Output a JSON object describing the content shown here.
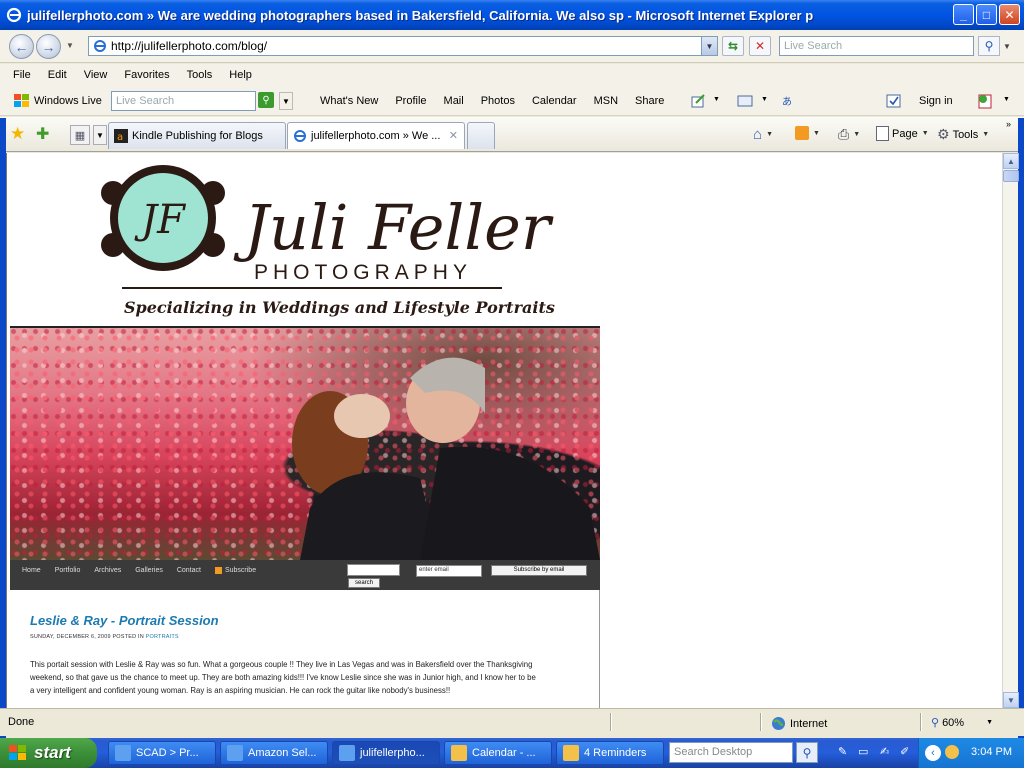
{
  "window": {
    "title": "julifellerphoto.com » We are wedding photographers based in Bakersfield, California. We also sp - Microsoft Internet Explorer p"
  },
  "address_bar": {
    "url": "http://julifellerphoto.com/blog/",
    "search_placeholder": "Live Search"
  },
  "menu": [
    "File",
    "Edit",
    "View",
    "Favorites",
    "Tools",
    "Help"
  ],
  "live_toolbar": {
    "brand": "Windows Live",
    "search_placeholder": "Live Search",
    "links": [
      "What's New",
      "Profile",
      "Mail",
      "Photos",
      "Calendar",
      "MSN",
      "Share"
    ],
    "sign_in": "Sign in"
  },
  "tabs": [
    {
      "label": "Kindle Publishing for Blogs"
    },
    {
      "label": "julifellerphoto.com » We ..."
    }
  ],
  "command_bar": {
    "page": "Page",
    "tools": "Tools"
  },
  "site": {
    "logo_monogram": "JF",
    "logo_name": "Juli Feller",
    "logo_sub": "PHOTOGRAPHY",
    "tagline": "Specializing in Weddings and Lifestyle Portraits",
    "nav": [
      "Home",
      "Portfolio",
      "Archives",
      "Galleries",
      "Contact",
      "Subscribe"
    ],
    "search_button": "search",
    "email_placeholder": "enter email",
    "subscribe_button": "Subscribe by email"
  },
  "post": {
    "title": "Leslie & Ray - Portrait Session",
    "meta_prefix": "SUNDAY, DECEMBER 6, 2009 POSTED IN",
    "category": "PORTRAITS",
    "body": "This portait session with Leslie & Ray was so fun. What a gorgeous couple !! They live in Las Vegas and was in Bakersfield over the Thanksgiving weekend, so that gave us the chance to meet up. They are both amazing kids!!! I've know Leslie since she was in Junior high, and I know her to be a very intelligent and confident young woman. Ray is an aspiring musician. He can rock the guitar like nobody's business!!"
  },
  "status_bar": {
    "status": "Done",
    "zone": "Internet",
    "zoom": "60%"
  },
  "taskbar": {
    "start": "start",
    "buttons": [
      {
        "label": "SCAD > Pr..."
      },
      {
        "label": "Amazon Sel..."
      },
      {
        "label": "julifellerpho..."
      },
      {
        "label": "Calendar - ..."
      },
      {
        "label": "4 Reminders"
      }
    ],
    "search_placeholder": "Search Desktop",
    "clock": "3:04 PM"
  },
  "colors": {
    "title_blue": "#0054e3",
    "post_title": "#1c7bb0",
    "logo_teal": "#9fe3d2",
    "logo_brown": "#2b1a14"
  }
}
